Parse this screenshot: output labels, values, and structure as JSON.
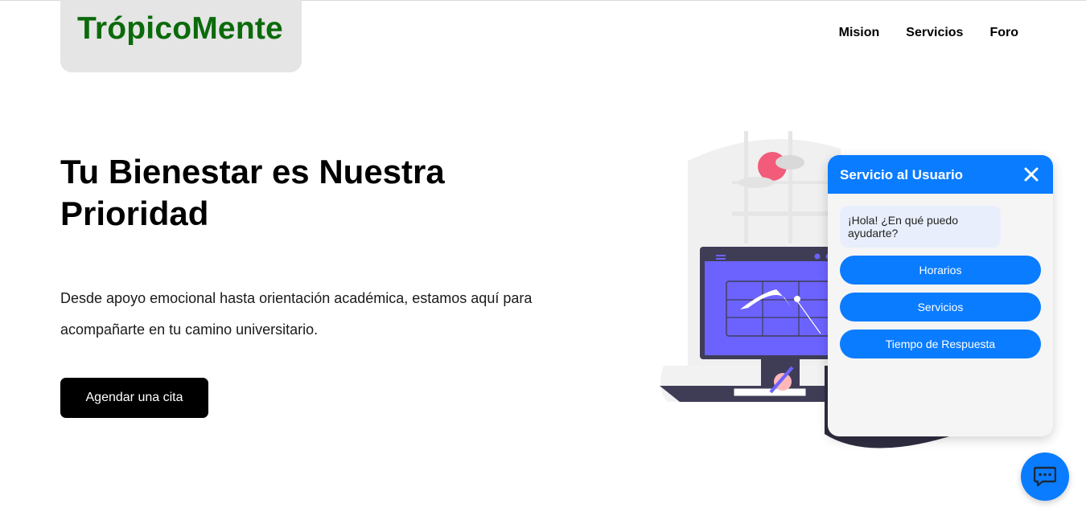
{
  "brand": {
    "logo_text": "TrópicoMente"
  },
  "nav": {
    "items": [
      "Mision",
      "Servicios",
      "Foro"
    ]
  },
  "hero": {
    "title": "Tu Bienestar es Nuestra Prioridad",
    "description": "Desde apoyo emocional hasta orientación académica, estamos aquí para acompañarte en tu camino universitario.",
    "cta_label": "Agendar una cita"
  },
  "chat": {
    "title": "Servicio al Usuario",
    "greeting": "¡Hola! ¿En qué puedo ayudarte?",
    "options": [
      "Horarios",
      "Servicios",
      "Tiempo de Respuesta"
    ],
    "close_icon": "close-icon",
    "launcher_icon": "chat-bubble-icon"
  },
  "colors": {
    "brand_green": "#0b6a0b",
    "accent_blue": "#0a7cff",
    "illustration_purple": "#6c63ff",
    "cta_black": "#000000"
  }
}
